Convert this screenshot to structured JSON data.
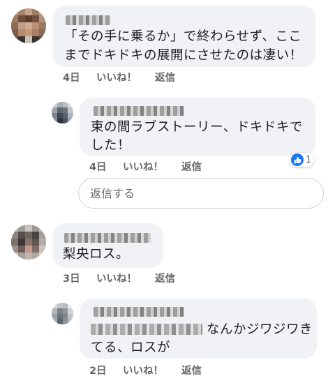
{
  "comments": [
    {
      "text_line1": "「その手に乗るか」で終わらせず、ここ",
      "text_line2": "までドキドキの展開にさせたのは凄い！",
      "time": "4日",
      "like_label": "いいね！",
      "reply_label": "返信"
    },
    {
      "text_line1": "束の間ラブストーリー、ドキドキで",
      "text_line2": "した！",
      "time": "4日",
      "like_label": "いいね！",
      "reply_label": "返信",
      "reaction_count": "1"
    },
    {
      "text_line1": "梨央ロス。",
      "time": "3日",
      "like_label": "いいね！",
      "reply_label": "返信"
    },
    {
      "text_line1_visible": "なんかジワジワき",
      "text_line2": "てる、ロスが",
      "time": "2日",
      "like_label": "いいね！",
      "reply_label": "返信"
    }
  ],
  "reply_box": {
    "placeholder": "返信する"
  },
  "colors": {
    "bubble": "#f0f2f5",
    "meta_text": "#65676b",
    "like_blue": "#1877f2"
  }
}
